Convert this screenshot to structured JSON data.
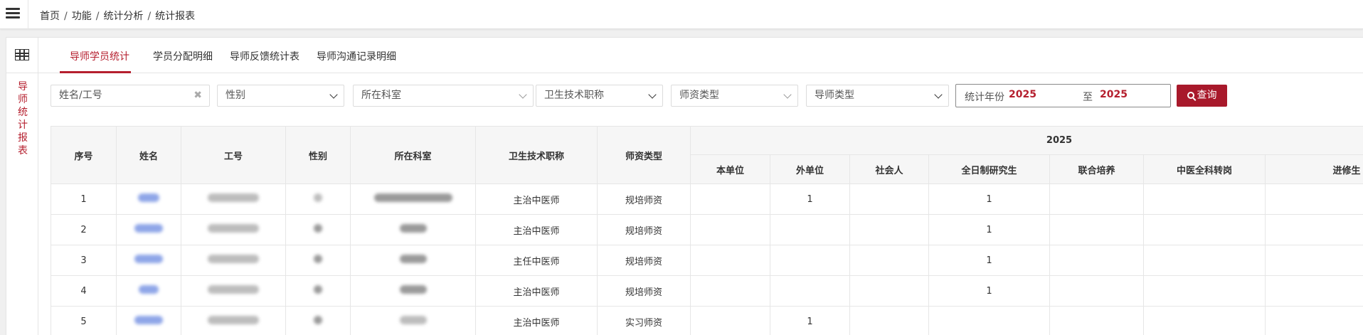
{
  "breadcrumb": [
    "首页",
    "功能",
    "统计分析",
    "统计报表"
  ],
  "side_title": [
    "导",
    "师",
    "统",
    "计",
    "报",
    "表"
  ],
  "tabs": [
    {
      "label": "导师学员统计",
      "active": true
    },
    {
      "label": "学员分配明细",
      "active": false
    },
    {
      "label": "导师反馈统计表",
      "active": false
    },
    {
      "label": "导师沟通记录明细",
      "active": false
    }
  ],
  "filters": {
    "name_placeholder": "姓名/工号",
    "gender": "性别",
    "department": "所在科室",
    "title": "卫生技术职称",
    "teacher_type": "师资类型",
    "mentor_type": "导师类型",
    "year_label": "统计年份",
    "year_from": "2025",
    "year_to_label": "至",
    "year_to": "2025",
    "search_label": "查询"
  },
  "table": {
    "columns": [
      "序号",
      "姓名",
      "工号",
      "性别",
      "所在科室",
      "卫生技术职称",
      "师资类型"
    ],
    "group_header": "2025",
    "sub_columns": [
      "本单位",
      "外单位",
      "社会人",
      "全日制研究生",
      "联合培养",
      "中医全科转岗",
      "进修生"
    ],
    "rows": [
      {
        "index": "1",
        "title": "主治中医师",
        "type": "规培师资",
        "counts": [
          "",
          "1",
          "",
          "1",
          "",
          "",
          ""
        ]
      },
      {
        "index": "2",
        "title": "主治中医师",
        "type": "规培师资",
        "counts": [
          "",
          "",
          "",
          "1",
          "",
          "",
          ""
        ]
      },
      {
        "index": "3",
        "title": "主任中医师",
        "type": "规培师资",
        "counts": [
          "",
          "",
          "",
          "1",
          "",
          "",
          ""
        ]
      },
      {
        "index": "4",
        "title": "主治中医师",
        "type": "规培师资",
        "counts": [
          "",
          "",
          "",
          "1",
          "",
          "",
          ""
        ]
      },
      {
        "index": "5",
        "title": "主治中医师",
        "type": "实习师资",
        "counts": [
          "",
          "1",
          "",
          "",
          "",
          "",
          ""
        ]
      }
    ]
  },
  "colors": {
    "accent": "#b51f2e",
    "link": "#2b5ca8"
  }
}
